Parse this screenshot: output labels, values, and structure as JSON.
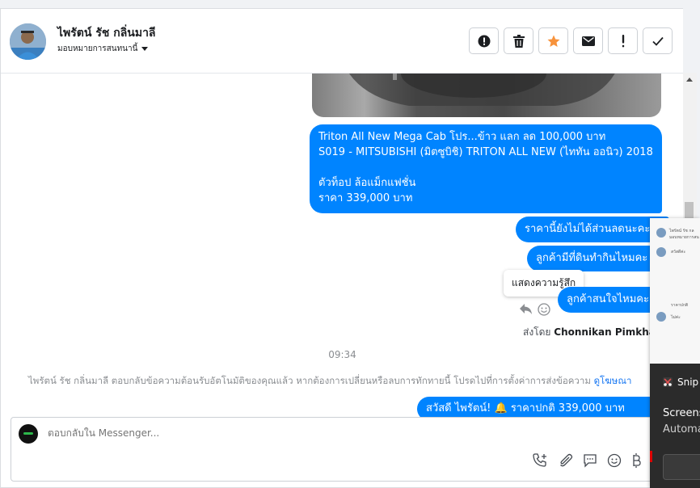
{
  "header": {
    "contact_name": "ไพรัตน์ รัช กลิ่นมาลี",
    "assign_label": "มอบหมายการสนทนานี้",
    "actions": [
      "spam-icon",
      "trash-icon",
      "star-icon",
      "mail-icon",
      "exclamation-icon",
      "check-icon"
    ],
    "star_color": "#f7923b"
  },
  "thread": {
    "msg1_lines": [
      "Triton All New Mega Cab โปร...ข้าว แลก ลด 100,000 บาท",
      "S019 - MITSUBISHI (มิตซูบิชิ) TRITON ALL NEW (ไททัน ออนิว) 2018",
      "",
      " ตัวท็อป ล้อแม็กแฟชั่น",
      "ราคา 339,000 บาท"
    ],
    "msg2": "ราคานี้ยังไม่ได้ส่วนลดนะคะ",
    "msg3": "ลูกค้ามีที่ดินทำกินไหมคะ",
    "msg4": "ลูกค้าสนใจไหมคะ",
    "tooltip": "แสดงความรู้สึก",
    "sent_by_prefix": "ส่งโดย",
    "sent_by_name": "Chonnikan Pimkham",
    "time": "09:34",
    "system_text": "ไพรัตน์ รัช กลิ่นมาลี ตอบกลับข้อความต้อนรับอัตโนมัติของคุณแล้ว หากต้องการเปลี่ยนหรือลบการทักทายนี้ โปรดไปที่การตั้งค่าการส่งข้อความ",
    "system_link": "ดูโฆษณา",
    "msg5": "สวัสดี ไพรัตน์! 🔔 ราคาปกติ 339,000 บาท",
    "bubble_color": "#0084ff"
  },
  "composer": {
    "placeholder": "ตอบกลับใน Messenger..."
  },
  "overlay": {
    "thumb_texts": [
      "ไพรัตน์ รัช กล",
      "มอบหมายการสน",
      "สวัสดีค่ะ",
      "ราคาปกติ",
      "ไม่ค่ะ"
    ],
    "notif_app": "Snip",
    "notif_title": "Screens",
    "notif_body": "Automa"
  }
}
